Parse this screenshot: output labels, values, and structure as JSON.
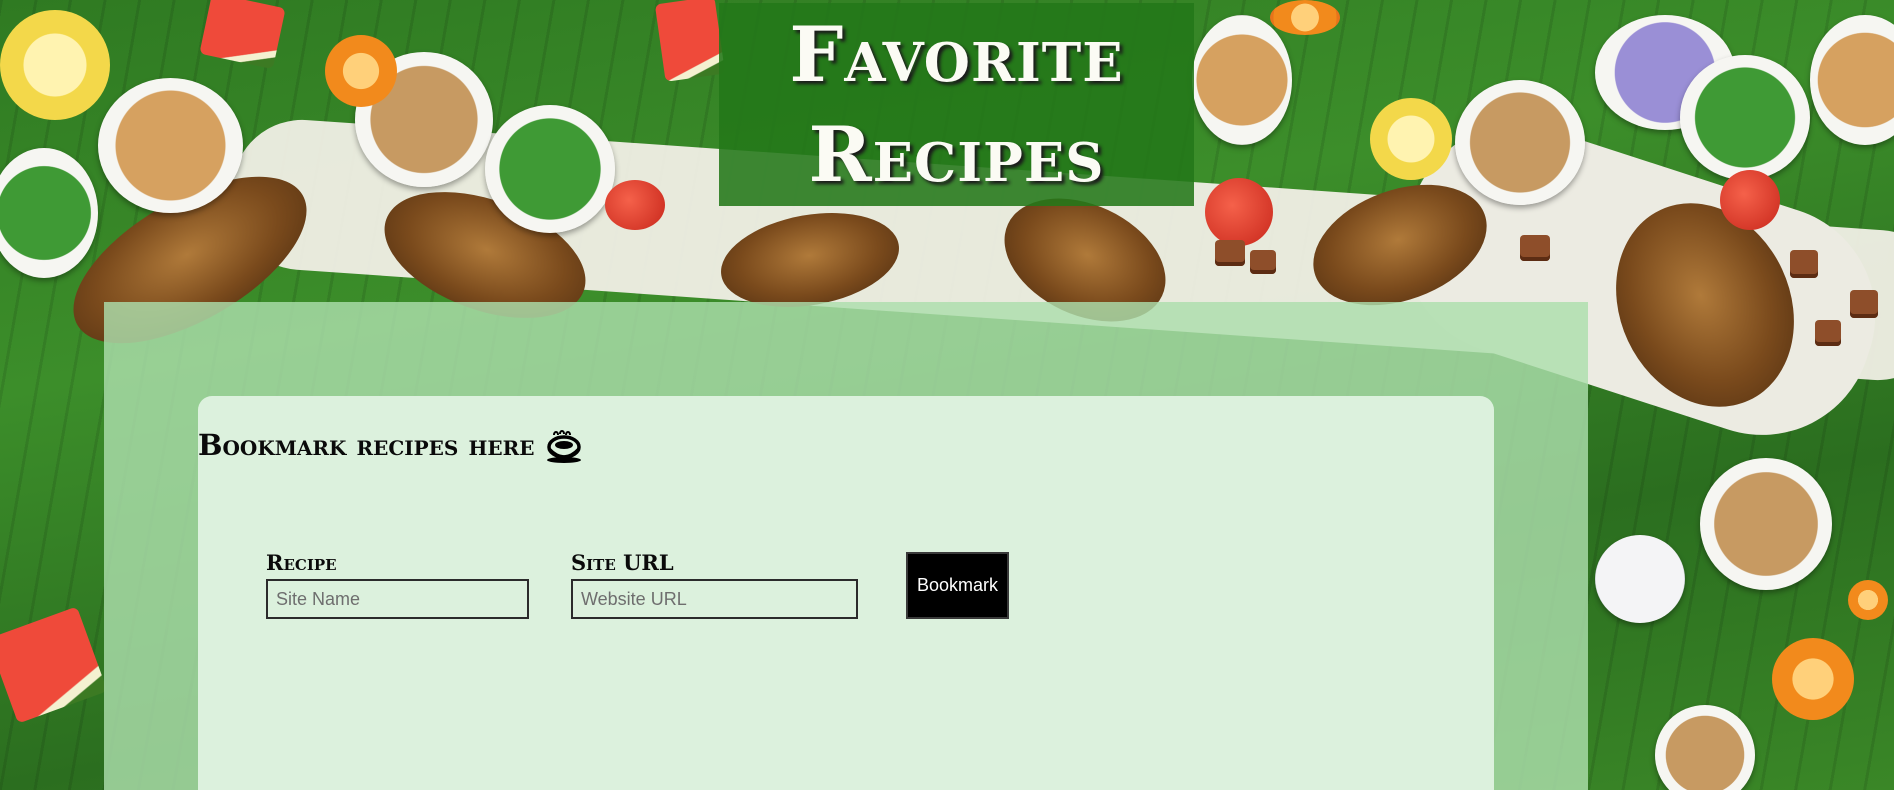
{
  "header": {
    "title_line1": "Favorite",
    "title_line2": "Recipes"
  },
  "card": {
    "heading": "Bookmark recipes here",
    "heading_icon": "coffee-cup-icon"
  },
  "form": {
    "recipe_label": "Recipe",
    "recipe_placeholder": "Site Name",
    "recipe_value": "",
    "url_label": "Site URL",
    "url_placeholder": "Website URL",
    "url_value": "",
    "submit_label": "Bookmark"
  },
  "colors": {
    "header_bg": "#237819",
    "panel_bg": "#acdeac",
    "card_bg": "#dcf1dd",
    "button_bg": "#000000",
    "button_text": "#ffffff"
  }
}
